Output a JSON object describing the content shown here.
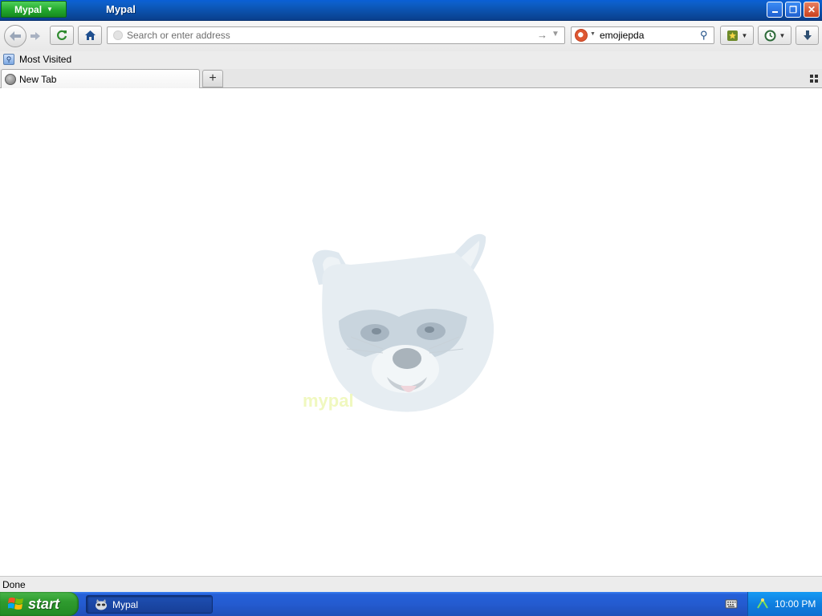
{
  "titlebar": {
    "app_menu_label": "Mypal",
    "window_title": "Mypal"
  },
  "navbar": {
    "url_placeholder": "Search or enter address",
    "url_value": "",
    "search_value": "emojiepda",
    "search_engine_icon": "duckduckgo-icon"
  },
  "bookmarks_bar": {
    "items": [
      {
        "label": "Most Visited",
        "icon": "most-visited-icon"
      }
    ]
  },
  "tabs": [
    {
      "label": "New Tab",
      "icon": "globe-icon",
      "active": true
    }
  ],
  "content": {
    "logo_text": "mypal"
  },
  "status_bar": {
    "text": "Done"
  },
  "taskbar": {
    "start_label": "start",
    "tasks": [
      {
        "label": "Mypal",
        "icon": "mypal-raccoon-icon"
      }
    ],
    "clock": "10:00 PM"
  },
  "colors": {
    "titlebar_blue": "#0b4fa8",
    "app_menu_green": "#23a82d",
    "taskbar_blue": "#245bd0",
    "tray_blue": "#0f7fe0",
    "start_green": "#2f9b2f"
  }
}
